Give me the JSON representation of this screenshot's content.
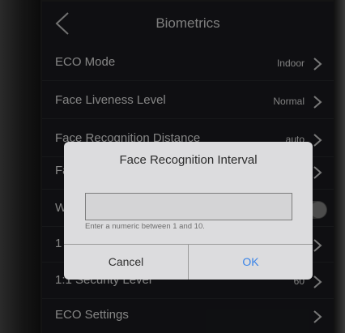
{
  "header": {
    "title": "Biometrics"
  },
  "settings": [
    {
      "label": "ECO Mode",
      "value": "Indoor"
    },
    {
      "label": "Face Liveness Level",
      "value": "Normal"
    },
    {
      "label": "Face Recognition Distance",
      "value": "auto"
    },
    {
      "label": "Fa",
      "value": ""
    },
    {
      "label": "W",
      "value": ""
    },
    {
      "label": "1",
      "value": ""
    },
    {
      "label": "1:1 Security Level",
      "value": "60"
    },
    {
      "label": "ECO Settings",
      "value": ""
    }
  ],
  "dialog": {
    "title": "Face Recognition Interval",
    "input_value": "",
    "hint": "Enter a numeric between 1 and 10.",
    "cancel_label": "Cancel",
    "ok_label": "OK"
  },
  "colors": {
    "accent": "#3a84e8",
    "screen_bg": "#1c1d21",
    "dialog_bg": "#dcdcde"
  }
}
